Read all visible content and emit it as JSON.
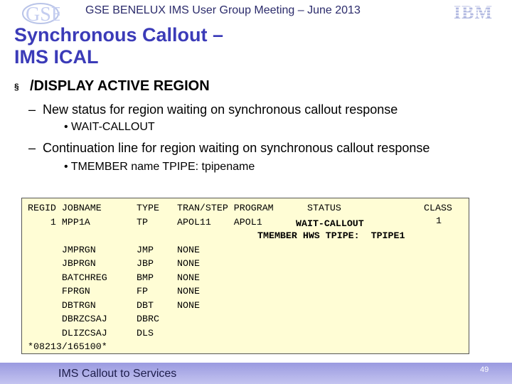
{
  "header": {
    "conference_title": "GSE BENELUX IMS User Group Meeting – June 2013",
    "logo_left_text": "GSE",
    "logo_right_text": "IBM"
  },
  "slide": {
    "title_line1": "Synchronous Callout –",
    "title_line2": "IMS ICAL",
    "bullet1": "/DISPLAY ACTIVE REGION",
    "bullet1_marker": "§",
    "sub1_dash": "–",
    "sub1": "New status for region waiting on synchronous callout response",
    "sub1_item": "• WAIT-CALLOUT",
    "sub2_dash": "–",
    "sub2": "Continuation line for region waiting on synchronous callout response",
    "sub2_item": "• TMEMBER name TPIPE: tpipename"
  },
  "console": {
    "col_regid_job": "REGID JOBNAME\n    1 MPP1A\n\n      JMPRGN\n      JBPRGN\n      BATCHREG\n      FPRGN\n      DBTRGN\n      DBRZCSAJ\n      DLIZCSAJ\n*08213/165100*",
    "col_type": "TYPE\nTP\n\nJMP\nJBP\nBMP\nFP\nDBT\nDBRC\nDLS",
    "col_tran": "TRAN/STEP PROGRAM\nAPOL11    APOL1\n\nNONE\nNONE\nNONE\nNONE\nNONE",
    "status_header": "STATUS",
    "status_value": "WAIT-CALLOUT",
    "class_header": "CLASS",
    "class_value": "1",
    "tmember_line": "TMEMBER HWS TPIPE:  TPIPE1"
  },
  "footer": {
    "text": "IMS Callout to Services",
    "page_number": "49"
  },
  "colors": {
    "title": "#3b3bb8",
    "console_bg": "#fffdd5",
    "footer_bg": "#a8a8e6"
  }
}
